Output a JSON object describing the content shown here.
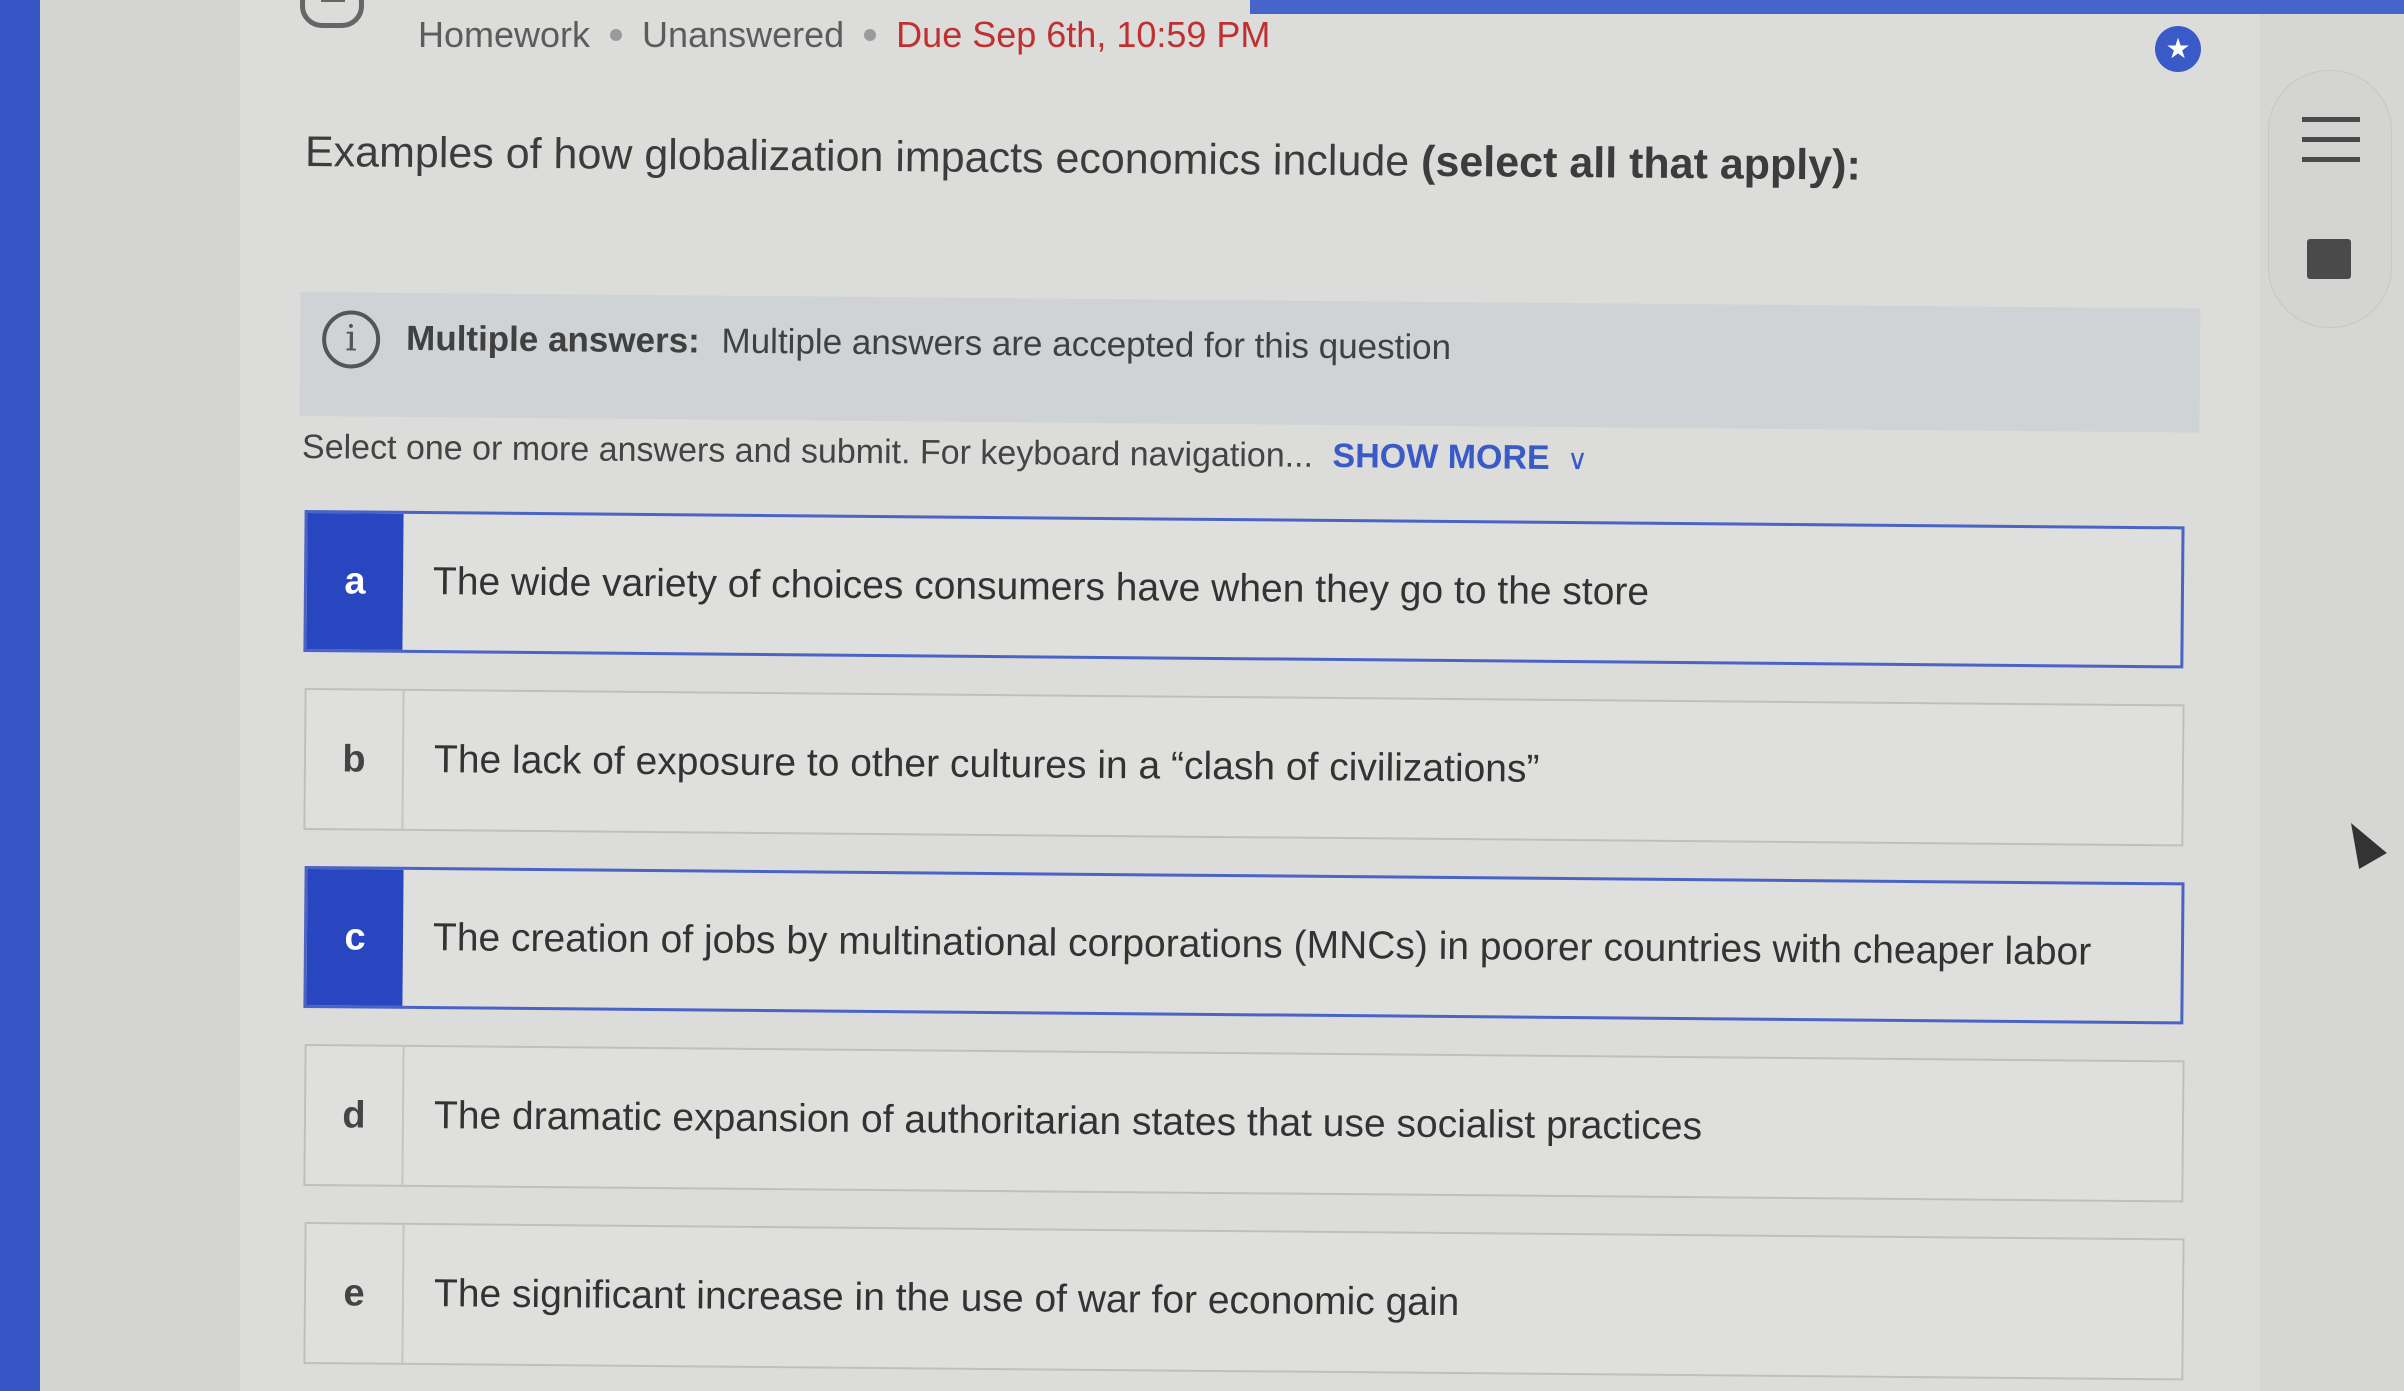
{
  "header": {
    "type": "Homework",
    "status": "Unanswered",
    "due": "Due Sep 6th, 10:59 PM"
  },
  "question": {
    "prompt": "Examples of how globalization impacts economics include",
    "emphasis": "(select all that apply):"
  },
  "info": {
    "title": "Multiple answers:",
    "text": "Multiple answers are accepted for this question"
  },
  "instruction": {
    "text": "Select one or more answers and submit. For keyboard navigation...",
    "show_more": "SHOW MORE"
  },
  "options": [
    {
      "letter": "a",
      "text": "The wide variety of choices consumers have when they go to the store",
      "selected": true
    },
    {
      "letter": "b",
      "text": "The lack of exposure to other cultures in a “clash of civilizations”",
      "selected": false
    },
    {
      "letter": "c",
      "text": "The creation of jobs by multinational corporations (MNCs) in poorer countries with cheaper labor",
      "selected": true
    },
    {
      "letter": "d",
      "text": "The dramatic expansion of authoritarian states that use socialist practices",
      "selected": false
    },
    {
      "letter": "e",
      "text": "The significant increase in the use of war for economic gain",
      "selected": false
    }
  ],
  "icons": {
    "star": "star-icon",
    "info": "info-icon",
    "list": "list-icon",
    "notebook": "notebook-icon",
    "chevron": "chevron-down-icon",
    "cursor": "cursor-icon"
  },
  "colors": {
    "accent": "#2846c0",
    "due": "#c03030"
  }
}
